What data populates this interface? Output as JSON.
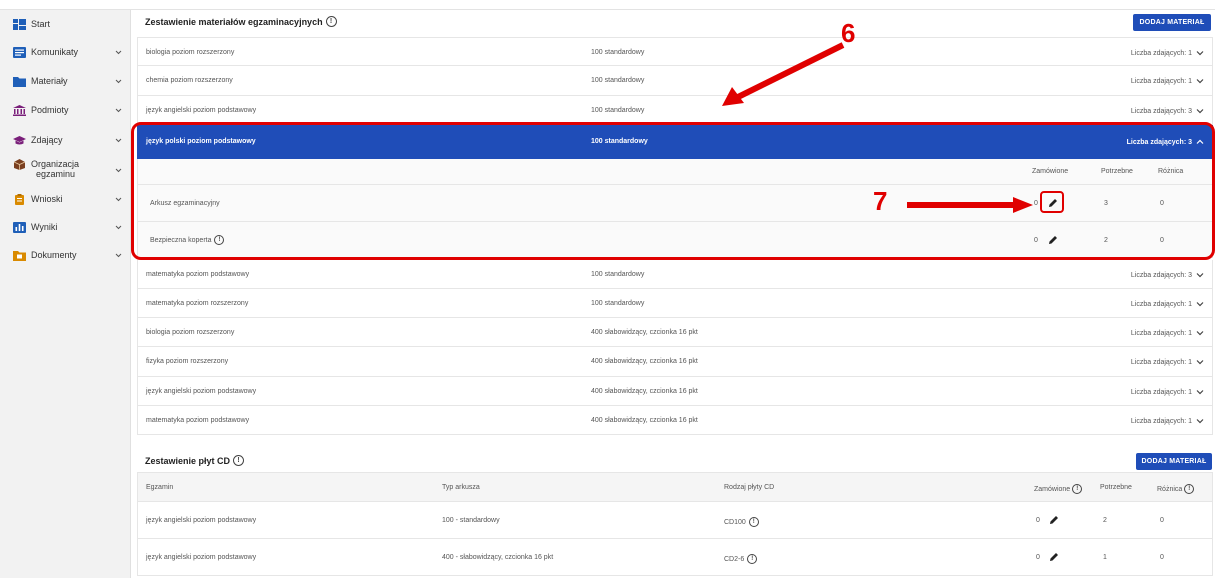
{
  "sidebar": {
    "items": [
      {
        "label": "Start",
        "icon": "dashboard-icon",
        "color": "#1f5fb8",
        "chevron": false
      },
      {
        "label": "Komunikaty",
        "icon": "messages-icon",
        "color": "#1f5fb8",
        "chevron": true
      },
      {
        "label": "Materiały",
        "icon": "folder-icon",
        "color": "#1f5fb8",
        "chevron": true
      },
      {
        "label": "Podmioty",
        "icon": "institution-icon",
        "color": "#7a1f7a",
        "chevron": true
      },
      {
        "label": "Zdający",
        "icon": "graduation-cap-icon",
        "color": "#7a1f7a",
        "chevron": true
      },
      {
        "label": "Organizacja egzaminu",
        "label_line1": "Organizacja",
        "label_line2": "egzaminu",
        "icon": "box-icon",
        "color": "#7a3f1f",
        "chevron": true
      },
      {
        "label": "Wnioski",
        "icon": "clipboard-icon",
        "color": "#d98a00",
        "chevron": true
      },
      {
        "label": "Wyniki",
        "icon": "chart-icon",
        "color": "#1f5fb8",
        "chevron": true
      },
      {
        "label": "Dokumenty",
        "icon": "documents-folder-icon",
        "color": "#d98a00",
        "chevron": true
      }
    ]
  },
  "materials": {
    "title": "Zestawienie materiałów egzaminacyjnych",
    "add_button": "DODAJ MATERIAŁ",
    "rows": [
      {
        "exam": "biologia poziom rozszerzony",
        "type": "100 standardowy",
        "count": "Liczba zdających: 1"
      },
      {
        "exam": "chemia poziom rozszerzony",
        "type": "100 standardowy",
        "count": "Liczba zdających: 1"
      },
      {
        "exam": "język angielski poziom podstawowy",
        "type": "100 standardowy",
        "count": "Liczba zdających: 3"
      },
      {
        "exam": "język polski poziom podstawowy",
        "type": "100 standardowy",
        "count": "Liczba zdających: 3"
      },
      {
        "exam": "matematyka poziom podstawowy",
        "type": "100 standardowy",
        "count": "Liczba zdających: 3"
      },
      {
        "exam": "matematyka poziom rozszerzony",
        "type": "100 standardowy",
        "count": "Liczba zdających: 1"
      },
      {
        "exam": "biologia poziom rozszerzony",
        "type": "400 słabowidzący, czcionka 16 pkt",
        "count": "Liczba zdających: 1"
      },
      {
        "exam": "fizyka poziom rozszerzony",
        "type": "400 słabowidzący, czcionka 16 pkt",
        "count": "Liczba zdających: 1"
      },
      {
        "exam": "język angielski poziom podstawowy",
        "type": "400 słabowidzący, czcionka 16 pkt",
        "count": "Liczba zdających: 1"
      },
      {
        "exam": "matematyka poziom podstawowy",
        "type": "400 słabowidzący, czcionka 16 pkt",
        "count": "Liczba zdających: 1"
      }
    ],
    "expanded": {
      "headers": {
        "ordered": "Zamówione",
        "needed": "Potrzebne",
        "diff": "Różnica"
      },
      "items": [
        {
          "name": "Arkusz egzaminacyjny",
          "ordered": "0",
          "needed": "3",
          "diff": "0"
        },
        {
          "name": "Bezpieczna koperta",
          "ordered": "0",
          "needed": "2",
          "diff": "0"
        }
      ]
    }
  },
  "annotations": {
    "arrow6": "6",
    "arrow7": "7",
    "color": "#e00000"
  },
  "cds": {
    "title": "Zestawienie płyt CD",
    "add_button": "DODAJ MATERIAŁ",
    "headers": {
      "exam": "Egzamin",
      "type": "Typ arkusza",
      "cd": "Rodzaj płyty CD",
      "ordered": "Zamówione",
      "needed": "Potrzebne",
      "diff": "Różnica"
    },
    "rows": [
      {
        "exam": "język angielski poziom podstawowy",
        "type": "100 - standardowy",
        "cd": "CD100",
        "ordered": "0",
        "needed": "2",
        "diff": "0"
      },
      {
        "exam": "język angielski poziom podstawowy",
        "type": "400 - słabowidzący, czcionka 16 pkt",
        "cd": "CD2-6",
        "ordered": "0",
        "needed": "1",
        "diff": "0"
      }
    ]
  },
  "info_glyph": "!"
}
